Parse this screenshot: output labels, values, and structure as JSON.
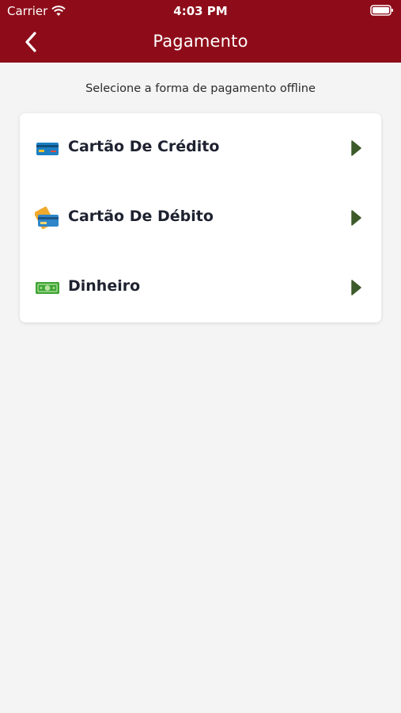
{
  "status_bar": {
    "carrier": "Carrier",
    "time": "4:03 PM"
  },
  "header": {
    "title": "Pagamento",
    "color": "#8e0c19"
  },
  "subtitle": "Selecione a forma de pagamento offline",
  "payment_options": [
    {
      "label": "Cartão De Crédito",
      "icon": "credit-card-icon"
    },
    {
      "label": "Cartão De Débito",
      "icon": "debit-card-icon"
    },
    {
      "label": "Dinheiro",
      "icon": "cash-icon"
    }
  ],
  "colors": {
    "arrow": "#3d5a2a",
    "text": "#1e2230"
  }
}
